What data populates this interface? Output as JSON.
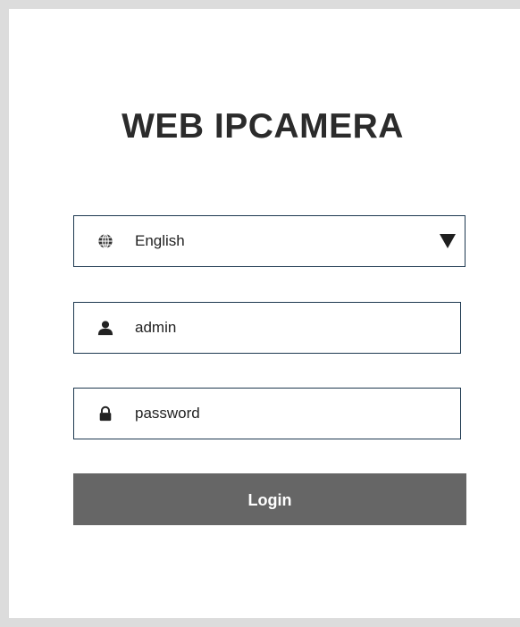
{
  "title": "WEB IPCAMERA",
  "language": {
    "icon": "globe-icon",
    "selected": "English"
  },
  "username": {
    "icon": "user-icon",
    "value": "admin"
  },
  "password": {
    "icon": "lock-icon",
    "value": "password"
  },
  "login_label": "Login",
  "colors": {
    "border": "#1d3850",
    "login_button": "#666666",
    "frame": "#dcdcdc",
    "title": "#2b2b2b"
  }
}
